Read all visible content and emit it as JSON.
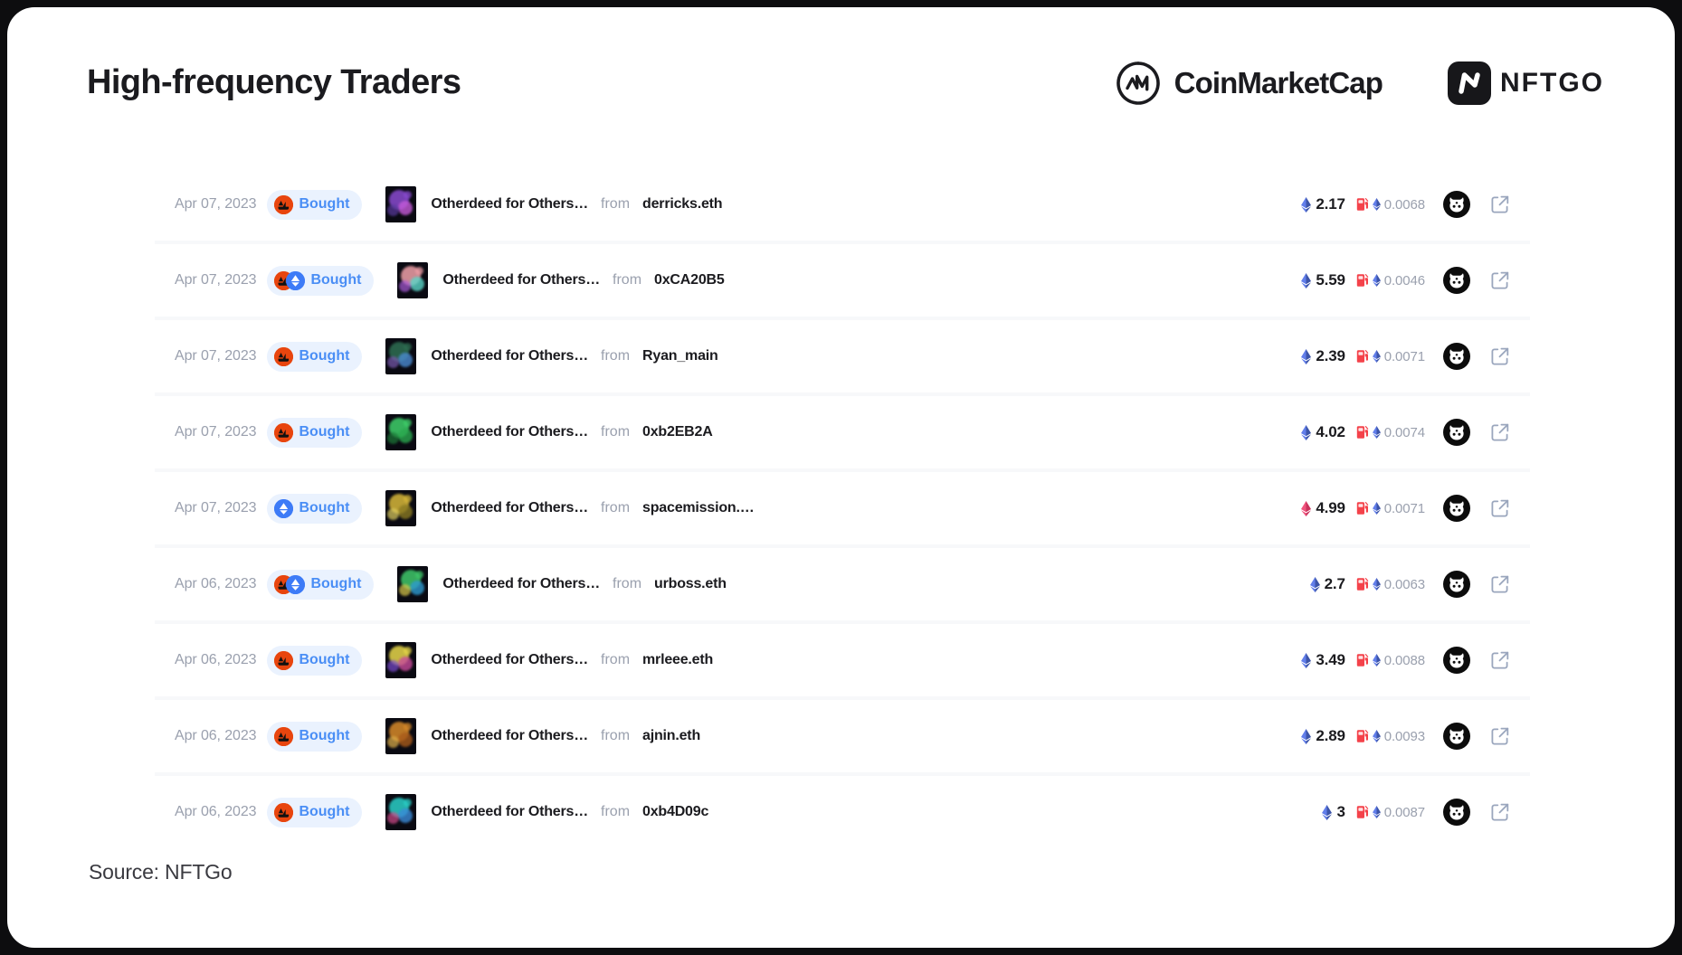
{
  "header": {
    "title": "High-frequency Traders",
    "logos": [
      {
        "name": "coinmarketcap",
        "text": "CoinMarketCap"
      },
      {
        "name": "nftgo",
        "text": "NFTGO"
      }
    ]
  },
  "colors": {
    "badge_bg": "#eaf2fe",
    "badge_text": "#4a8ef5",
    "opensea": "#e8450e",
    "blur": "#3d7bf7",
    "gas_red": "#f4424a",
    "eth_blue": "#627eea",
    "eth_pink": "#f0547d",
    "muted": "#9aa0ae",
    "text": "#1b1b1f",
    "row_bg": "#ffffff",
    "gap_bg": "#f7f8fa",
    "page_bg": "#ffffff",
    "frame_bg": "#0d0d0f"
  },
  "table": {
    "rows": [
      {
        "date": "Apr 07, 2023",
        "action": "Bought",
        "marketplaces": [
          "opensea"
        ],
        "nft": "Otherdeed for Others…",
        "from_label": "from",
        "wallet": "derricks.eth",
        "price": "2.17",
        "price_currency": "ETH",
        "eth_color": "blue",
        "gas": "0.0068",
        "thumb_colors": [
          "#8a4bd1",
          "#c45ad8",
          "#5a3a9e"
        ]
      },
      {
        "date": "Apr 07, 2023",
        "action": "Bought",
        "marketplaces": [
          "opensea",
          "blur"
        ],
        "nft": "Otherdeed for Others…",
        "from_label": "from",
        "wallet": "0xCA20B5",
        "price": "5.59",
        "price_currency": "ETH",
        "eth_color": "blue",
        "gas": "0.0046",
        "thumb_colors": [
          "#f0a0a8",
          "#5ad6c8",
          "#a85ad8"
        ]
      },
      {
        "date": "Apr 07, 2023",
        "action": "Bought",
        "marketplaces": [
          "opensea"
        ],
        "nft": "Otherdeed for Others…",
        "from_label": "from",
        "wallet": "Ryan_main",
        "price": "2.39",
        "price_currency": "ETH",
        "eth_color": "blue",
        "gas": "0.0071",
        "thumb_colors": [
          "#2e6e52",
          "#4a8ad0",
          "#7a5ab0"
        ]
      },
      {
        "date": "Apr 07, 2023",
        "action": "Bought",
        "marketplaces": [
          "opensea"
        ],
        "nft": "Otherdeed for Others…",
        "from_label": "from",
        "wallet": "0xb2EB2A",
        "price": "4.02",
        "price_currency": "ETH",
        "eth_color": "blue",
        "gas": "0.0074",
        "thumb_colors": [
          "#3fd06a",
          "#2aa84e",
          "#1d7a38"
        ]
      },
      {
        "date": "Apr 07, 2023",
        "action": "Bought",
        "marketplaces": [
          "blur"
        ],
        "nft": "Otherdeed for Others…",
        "from_label": "from",
        "wallet": "spacemission.…",
        "price": "4.99",
        "price_currency": "ETH",
        "eth_color": "pink",
        "gas": "0.0071",
        "thumb_colors": [
          "#d8b83a",
          "#8a7a22",
          "#e0cf60"
        ]
      },
      {
        "date": "Apr 06, 2023",
        "action": "Bought",
        "marketplaces": [
          "opensea",
          "blur"
        ],
        "nft": "Otherdeed for Others…",
        "from_label": "from",
        "wallet": "urboss.eth",
        "price": "2.7",
        "price_currency": "ETH",
        "eth_color": "blue",
        "gas": "0.0063",
        "thumb_colors": [
          "#3fc86a",
          "#2e9ad0",
          "#d8c84a"
        ]
      },
      {
        "date": "Apr 06, 2023",
        "action": "Bought",
        "marketplaces": [
          "opensea"
        ],
        "nft": "Otherdeed for Others…",
        "from_label": "from",
        "wallet": "mrleee.eth",
        "price": "3.49",
        "price_currency": "ETH",
        "eth_color": "blue",
        "gas": "0.0088",
        "thumb_colors": [
          "#e8d84a",
          "#c84a9a",
          "#7a4ad0"
        ]
      },
      {
        "date": "Apr 06, 2023",
        "action": "Bought",
        "marketplaces": [
          "opensea"
        ],
        "nft": "Otherdeed for Others…",
        "from_label": "from",
        "wallet": "ajnin.eth",
        "price": "2.89",
        "price_currency": "ETH",
        "eth_color": "blue",
        "gas": "0.0093",
        "thumb_colors": [
          "#d88a2a",
          "#a85a1a",
          "#e0b04a"
        ]
      },
      {
        "date": "Apr 06, 2023",
        "action": "Bought",
        "marketplaces": [
          "opensea"
        ],
        "nft": "Otherdeed for Others…",
        "from_label": "from",
        "wallet": "0xb4D09c",
        "price": "3",
        "price_currency": "ETH",
        "eth_color": "blue",
        "gas": "0.0087",
        "thumb_colors": [
          "#2ad0c8",
          "#3a8ad8",
          "#d04a8a"
        ]
      }
    ]
  },
  "footer": {
    "source": "Source: NFTGo"
  }
}
